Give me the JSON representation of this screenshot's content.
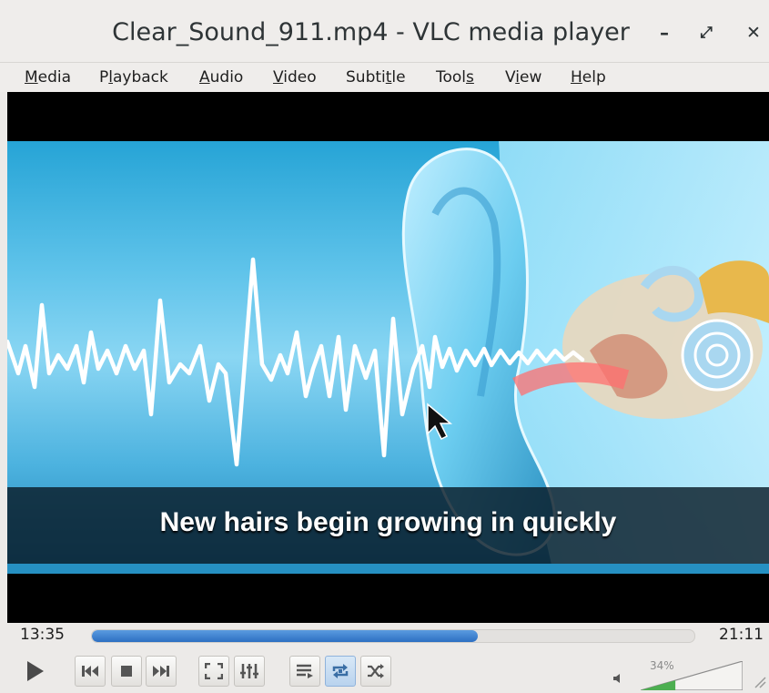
{
  "window": {
    "title": "Clear_Sound_911.mp4 - VLC media player",
    "controls": {
      "minimize": "–",
      "maximize": "⤢",
      "close": "✕"
    }
  },
  "menu": [
    {
      "label": "Media",
      "mnemonic": "M",
      "rest": "edia"
    },
    {
      "label": "Playback",
      "pre": "P",
      "mnemonic": "l",
      "rest": "ayback"
    },
    {
      "label": "Audio",
      "mnemonic": "A",
      "rest": "udio"
    },
    {
      "label": "Video",
      "mnemonic": "V",
      "rest": "ideo"
    },
    {
      "label": "Subtitle",
      "pre": "Subti",
      "mnemonic": "t",
      "rest": "le"
    },
    {
      "label": "Tools",
      "pre": "Tool",
      "mnemonic": "s",
      "rest": ""
    },
    {
      "label": "View",
      "pre": "V",
      "mnemonic": "i",
      "rest": "ew"
    },
    {
      "label": "Help",
      "mnemonic": "H",
      "rest": "elp"
    }
  ],
  "video": {
    "subtitle": "New hairs begin growing in quickly"
  },
  "playback": {
    "elapsed": "13:35",
    "total": "21:11",
    "progress": 0.64
  },
  "controls": {
    "buttons": [
      {
        "name": "play-button",
        "icon": "play-icon"
      },
      {
        "name": "previous-button",
        "icon": "skip-back-icon"
      },
      {
        "name": "stop-button",
        "icon": "stop-icon"
      },
      {
        "name": "next-button",
        "icon": "skip-forward-icon"
      },
      {
        "name": "fullscreen-button",
        "icon": "fullscreen-icon"
      },
      {
        "name": "extended-settings-button",
        "icon": "equalizer-icon"
      },
      {
        "name": "playlist-button",
        "icon": "playlist-icon"
      },
      {
        "name": "loop-button",
        "icon": "loop-icon",
        "active": true
      },
      {
        "name": "shuffle-button",
        "icon": "shuffle-icon"
      }
    ],
    "volume": {
      "label": "34%",
      "level": 0.34
    }
  },
  "colors": {
    "accent": "#2d6fc2",
    "volume_fill": "#4caf50",
    "video_bg": "#000000"
  }
}
